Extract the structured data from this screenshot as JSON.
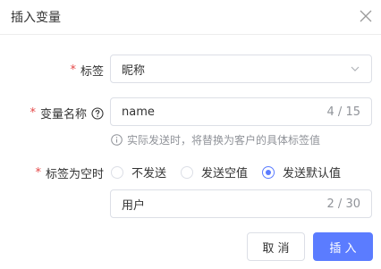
{
  "dialog": {
    "title": "插入变量",
    "fields": {
      "tag": {
        "required_mark": "*",
        "label": "标签",
        "value": "昵称"
      },
      "var_name": {
        "required_mark": "*",
        "label": "变量名称",
        "value": "name",
        "count": "4 / 15",
        "help_icon": "question-circle-icon"
      },
      "hint": {
        "icon": "info-circle-icon",
        "text": "实际发送时，将替换为客户的具体标签值"
      },
      "empty_rule": {
        "required_mark": "*",
        "label": "标签为空时",
        "options": [
          "不发送",
          "发送空值",
          "发送默认值"
        ],
        "selected": "发送默认值"
      },
      "default_value": {
        "value": "用户",
        "count": "2 / 30"
      }
    },
    "buttons": {
      "cancel": "取 消",
      "insert": "插 入"
    }
  },
  "colors": {
    "accent": "#5b7cff",
    "required": "#e54848",
    "muted": "#909399",
    "border": "#dcdfe6"
  }
}
